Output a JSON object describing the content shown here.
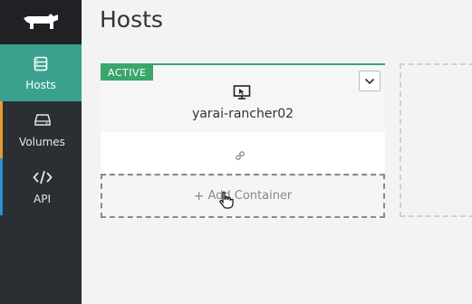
{
  "sidebar": {
    "items": [
      {
        "label": "Hosts",
        "icon": "server-icon"
      },
      {
        "label": "Volumes",
        "icon": "disk-icon"
      },
      {
        "label": "API",
        "icon": "code-icon"
      }
    ]
  },
  "page": {
    "title": "Hosts"
  },
  "host": {
    "state": "ACTIVE",
    "name": "yarai-rancher02",
    "add_container_label": "Add Container"
  },
  "colors": {
    "accent": "#3aa18f",
    "active_badge": "#3aa66a",
    "sidebar_bg": "#2b2e33"
  }
}
